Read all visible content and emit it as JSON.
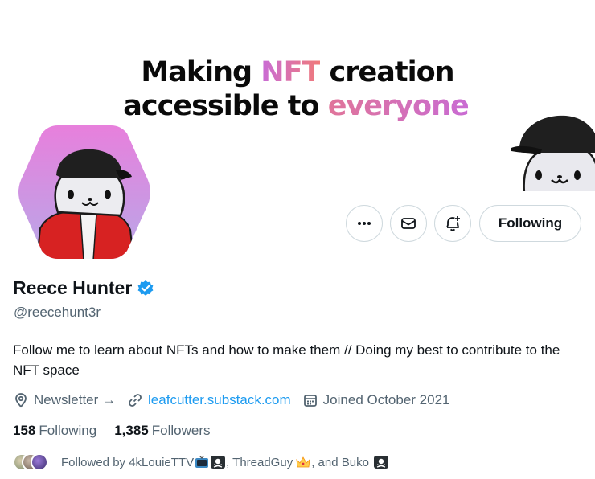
{
  "banner": {
    "line1_pre": "Making ",
    "line1_hl": "NFT",
    "line1_post": " creation",
    "line2_pre": "accessible to ",
    "line2_hl": "everyone"
  },
  "actions": {
    "more_label": "More",
    "message_label": "Message",
    "notify_label": "Turn on notifications",
    "following_label": "Following"
  },
  "profile": {
    "name": "Reece Hunter",
    "handle": "@reecehunt3r",
    "bio": "Follow me to learn about NFTs and how to make them // Doing my best to contribute to the NFT space",
    "location": "Newsletter →",
    "website": "leafcutter.substack.com",
    "joined": "Joined October 2021"
  },
  "stats": {
    "following_count": "158",
    "following_label": "Following",
    "followers_count": "1,385",
    "followers_label": "Followers"
  },
  "followed_by": {
    "prefix": "Followed by 4kLouieTTV",
    "name2": ", ThreadGuy",
    "name3": ", and Buko"
  },
  "colors": {
    "accent": "#1d9bf0",
    "muted": "#536471",
    "border": "#cfd9de",
    "avatar_bg_top": "#e87fdc",
    "avatar_bg_bottom": "#b7a8e8"
  }
}
